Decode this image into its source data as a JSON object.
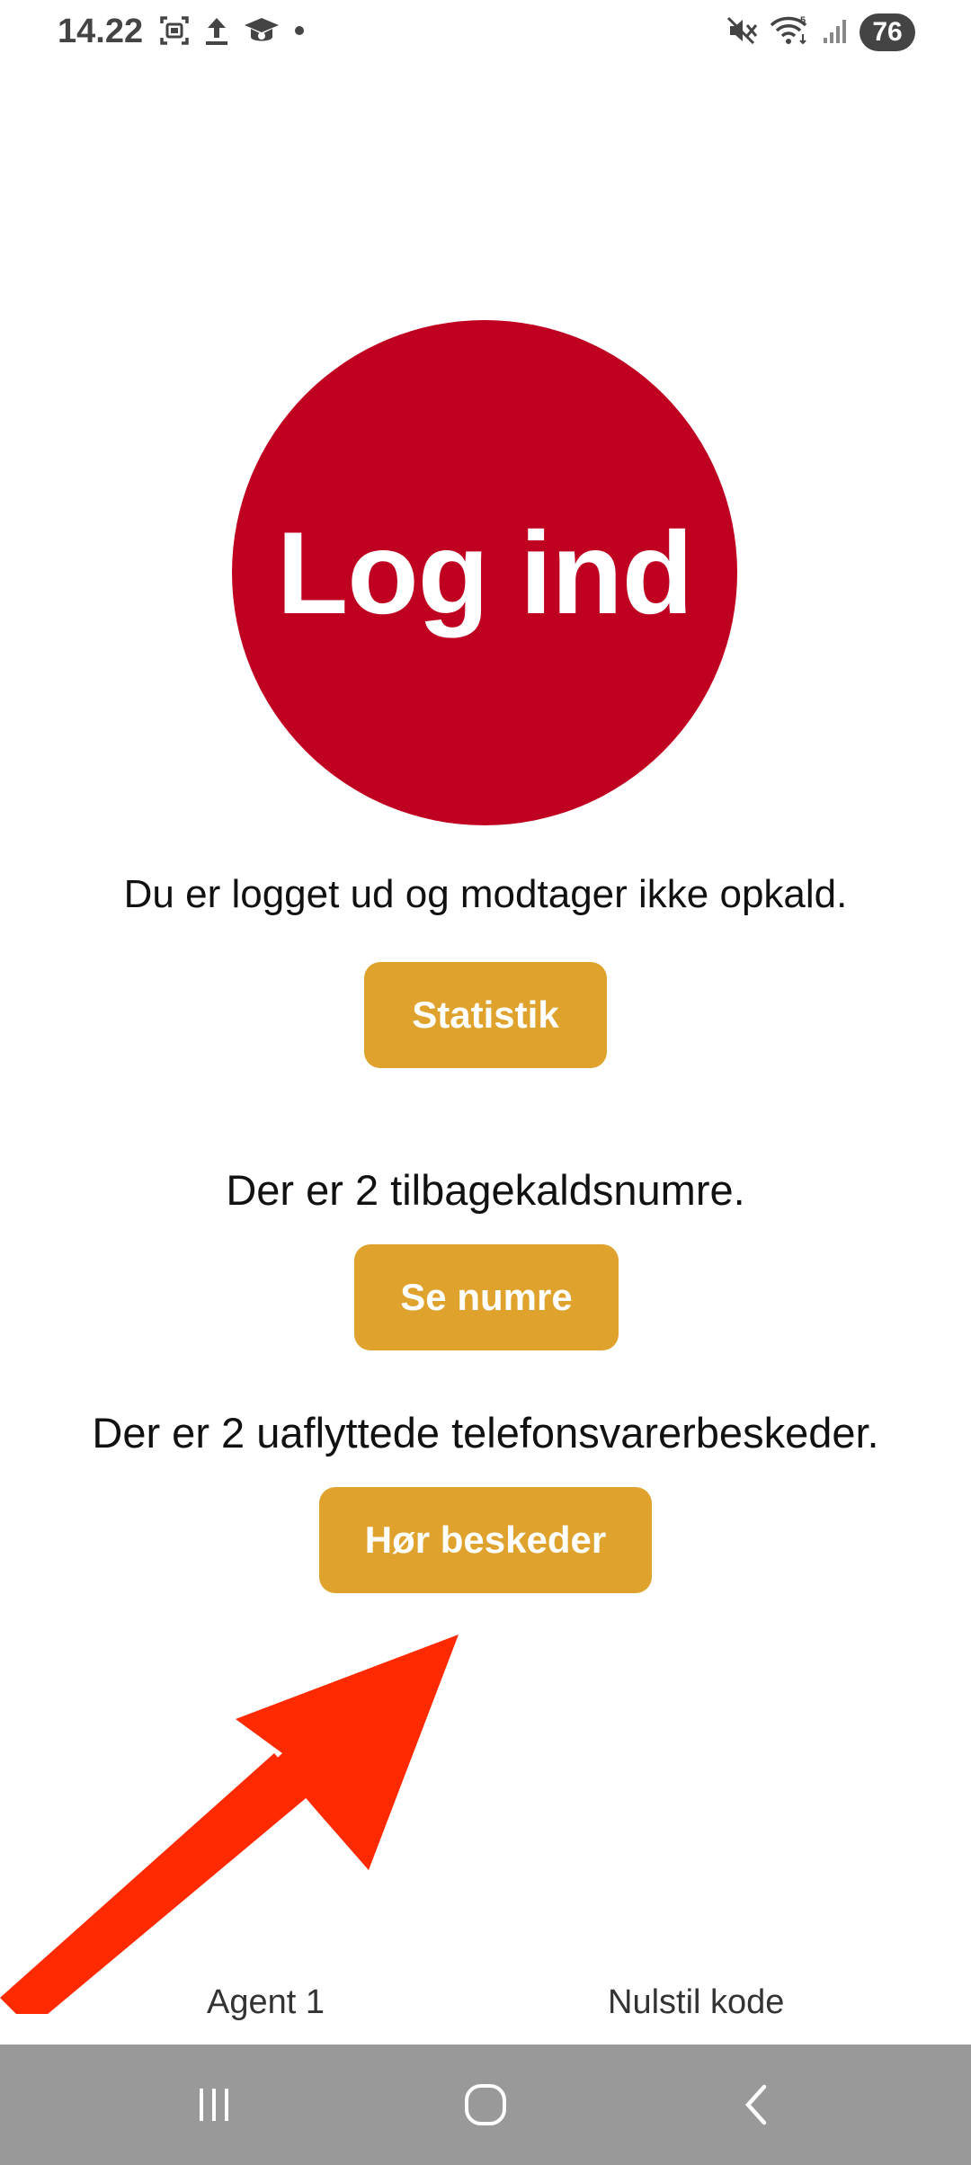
{
  "status_bar": {
    "time": "14.22",
    "battery": "76"
  },
  "login": {
    "label": "Log ind"
  },
  "messages": {
    "logged_out": "Du er logget ud og modtager ikke opkald.",
    "callbacks": "Der er 2 tilbagekaldsnumre.",
    "voicemails": "Der er 2 uaflyttede telefonsvarerbeskeder."
  },
  "buttons": {
    "statistics": "Statistik",
    "show_numbers": "Se numre",
    "listen_messages": "Hør beskeder"
  },
  "footer": {
    "agent": "Agent 1",
    "reset_code": "Nulstil kode"
  },
  "colors": {
    "login_red": "#c00020",
    "button_gold": "#dfa22c",
    "arrow_red": "#ff2a00",
    "nav_gray": "#999999"
  },
  "icons": {
    "screenshot": "screenshot-icon",
    "upload": "upload-icon",
    "graduation": "graduation-cap-icon",
    "dot": "notification-dot-icon",
    "mute": "mute-icon",
    "wifi": "wifi-icon",
    "signal": "signal-icon",
    "recents": "recents-icon",
    "home": "home-icon",
    "back": "back-icon"
  }
}
